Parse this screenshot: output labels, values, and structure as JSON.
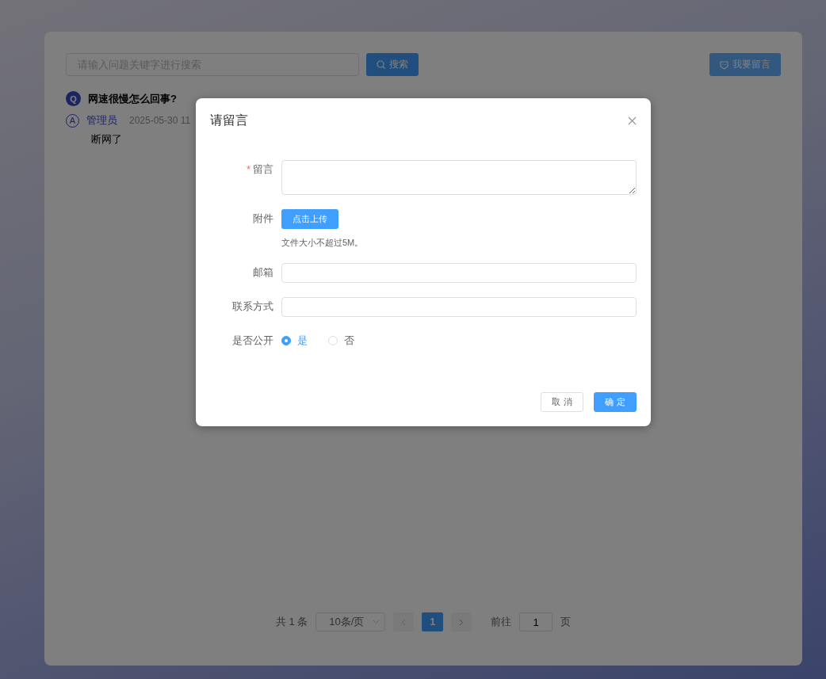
{
  "toolbar": {
    "search": {
      "placeholder": "请输入问题关键字进行搜索"
    },
    "search_button": "搜索",
    "post_button": "我要留言"
  },
  "questions": [
    {
      "badge": "Q",
      "title": "网速很慢怎么回事?",
      "answer": {
        "badge": "A",
        "author": "管理员",
        "time": "2025-05-30 11",
        "text": "断网了"
      }
    }
  ],
  "pagination": {
    "total": "共 1 条",
    "page_size": "10条/页",
    "pages": [
      {
        "label": "1",
        "selected": true
      }
    ],
    "goto_label": "前往",
    "goto_value": "1",
    "goto_suffix": "页"
  },
  "dialog": {
    "title": "请留言",
    "fields": [
      {
        "kind": "textarea",
        "label": "留言",
        "required_mark": "*"
      },
      {
        "kind": "upload",
        "label": "附件",
        "button": "点击上传",
        "tip": "文件大小不超过5M。"
      },
      {
        "kind": "input",
        "label": "邮箱"
      },
      {
        "kind": "input",
        "label": "联系方式"
      },
      {
        "kind": "radio",
        "label": "是否公开",
        "options": [
          {
            "label": "是",
            "selected": true
          },
          {
            "label": "否",
            "selected": false
          }
        ]
      }
    ],
    "buttons": [
      {
        "label": "取 消",
        "kind": "default"
      },
      {
        "label": "确 定",
        "kind": "primary"
      }
    ]
  }
}
